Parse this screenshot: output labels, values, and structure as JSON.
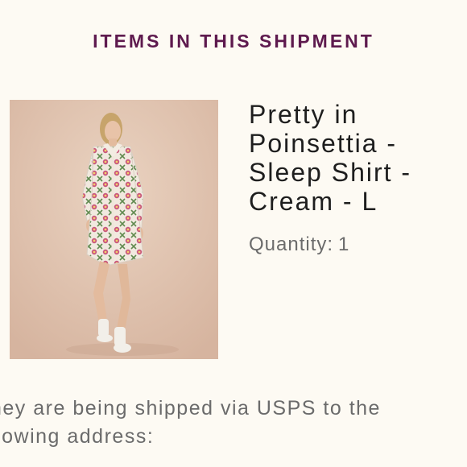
{
  "shipment": {
    "heading": "ITEMS IN THIS SHIPMENT",
    "item": {
      "title": "Pretty in Poinsettia - Sleep Shirt - Cream - L",
      "quantity_label": "Quantity:",
      "quantity_value": "1",
      "image_alt": "model wearing a cream sleep shirt with pink poinsettia print"
    },
    "shipping_note": "hey are being shipped via USPS to the\nllowing address:"
  }
}
